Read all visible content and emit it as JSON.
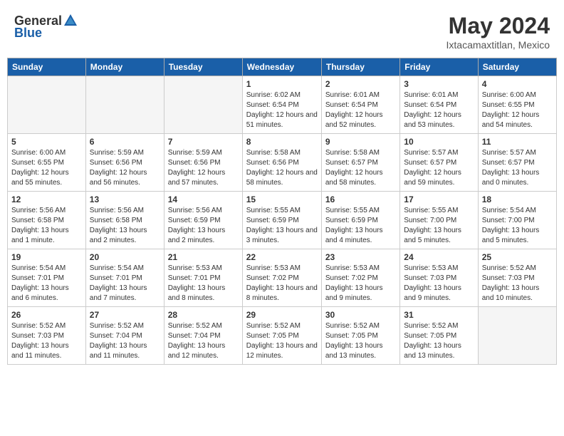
{
  "header": {
    "logo_general": "General",
    "logo_blue": "Blue",
    "title": "May 2024",
    "subtitle": "Ixtacamaxtitlan, Mexico"
  },
  "weekdays": [
    "Sunday",
    "Monday",
    "Tuesday",
    "Wednesday",
    "Thursday",
    "Friday",
    "Saturday"
  ],
  "weeks": [
    [
      {
        "day": "",
        "empty": true
      },
      {
        "day": "",
        "empty": true
      },
      {
        "day": "",
        "empty": true
      },
      {
        "day": "1",
        "sunrise": "6:02 AM",
        "sunset": "6:54 PM",
        "daylight": "12 hours and 51 minutes."
      },
      {
        "day": "2",
        "sunrise": "6:01 AM",
        "sunset": "6:54 PM",
        "daylight": "12 hours and 52 minutes."
      },
      {
        "day": "3",
        "sunrise": "6:01 AM",
        "sunset": "6:54 PM",
        "daylight": "12 hours and 53 minutes."
      },
      {
        "day": "4",
        "sunrise": "6:00 AM",
        "sunset": "6:55 PM",
        "daylight": "12 hours and 54 minutes."
      }
    ],
    [
      {
        "day": "5",
        "sunrise": "6:00 AM",
        "sunset": "6:55 PM",
        "daylight": "12 hours and 55 minutes."
      },
      {
        "day": "6",
        "sunrise": "5:59 AM",
        "sunset": "6:56 PM",
        "daylight": "12 hours and 56 minutes."
      },
      {
        "day": "7",
        "sunrise": "5:59 AM",
        "sunset": "6:56 PM",
        "daylight": "12 hours and 57 minutes."
      },
      {
        "day": "8",
        "sunrise": "5:58 AM",
        "sunset": "6:56 PM",
        "daylight": "12 hours and 58 minutes."
      },
      {
        "day": "9",
        "sunrise": "5:58 AM",
        "sunset": "6:57 PM",
        "daylight": "12 hours and 58 minutes."
      },
      {
        "day": "10",
        "sunrise": "5:57 AM",
        "sunset": "6:57 PM",
        "daylight": "12 hours and 59 minutes."
      },
      {
        "day": "11",
        "sunrise": "5:57 AM",
        "sunset": "6:57 PM",
        "daylight": "13 hours and 0 minutes."
      }
    ],
    [
      {
        "day": "12",
        "sunrise": "5:56 AM",
        "sunset": "6:58 PM",
        "daylight": "13 hours and 1 minute."
      },
      {
        "day": "13",
        "sunrise": "5:56 AM",
        "sunset": "6:58 PM",
        "daylight": "13 hours and 2 minutes."
      },
      {
        "day": "14",
        "sunrise": "5:56 AM",
        "sunset": "6:59 PM",
        "daylight": "13 hours and 2 minutes."
      },
      {
        "day": "15",
        "sunrise": "5:55 AM",
        "sunset": "6:59 PM",
        "daylight": "13 hours and 3 minutes."
      },
      {
        "day": "16",
        "sunrise": "5:55 AM",
        "sunset": "6:59 PM",
        "daylight": "13 hours and 4 minutes."
      },
      {
        "day": "17",
        "sunrise": "5:55 AM",
        "sunset": "7:00 PM",
        "daylight": "13 hours and 5 minutes."
      },
      {
        "day": "18",
        "sunrise": "5:54 AM",
        "sunset": "7:00 PM",
        "daylight": "13 hours and 5 minutes."
      }
    ],
    [
      {
        "day": "19",
        "sunrise": "5:54 AM",
        "sunset": "7:01 PM",
        "daylight": "13 hours and 6 minutes."
      },
      {
        "day": "20",
        "sunrise": "5:54 AM",
        "sunset": "7:01 PM",
        "daylight": "13 hours and 7 minutes."
      },
      {
        "day": "21",
        "sunrise": "5:53 AM",
        "sunset": "7:01 PM",
        "daylight": "13 hours and 8 minutes."
      },
      {
        "day": "22",
        "sunrise": "5:53 AM",
        "sunset": "7:02 PM",
        "daylight": "13 hours and 8 minutes."
      },
      {
        "day": "23",
        "sunrise": "5:53 AM",
        "sunset": "7:02 PM",
        "daylight": "13 hours and 9 minutes."
      },
      {
        "day": "24",
        "sunrise": "5:53 AM",
        "sunset": "7:03 PM",
        "daylight": "13 hours and 9 minutes."
      },
      {
        "day": "25",
        "sunrise": "5:52 AM",
        "sunset": "7:03 PM",
        "daylight": "13 hours and 10 minutes."
      }
    ],
    [
      {
        "day": "26",
        "sunrise": "5:52 AM",
        "sunset": "7:03 PM",
        "daylight": "13 hours and 11 minutes."
      },
      {
        "day": "27",
        "sunrise": "5:52 AM",
        "sunset": "7:04 PM",
        "daylight": "13 hours and 11 minutes."
      },
      {
        "day": "28",
        "sunrise": "5:52 AM",
        "sunset": "7:04 PM",
        "daylight": "13 hours and 12 minutes."
      },
      {
        "day": "29",
        "sunrise": "5:52 AM",
        "sunset": "7:05 PM",
        "daylight": "13 hours and 12 minutes."
      },
      {
        "day": "30",
        "sunrise": "5:52 AM",
        "sunset": "7:05 PM",
        "daylight": "13 hours and 13 minutes."
      },
      {
        "day": "31",
        "sunrise": "5:52 AM",
        "sunset": "7:05 PM",
        "daylight": "13 hours and 13 minutes."
      },
      {
        "day": "",
        "empty": true
      }
    ]
  ]
}
